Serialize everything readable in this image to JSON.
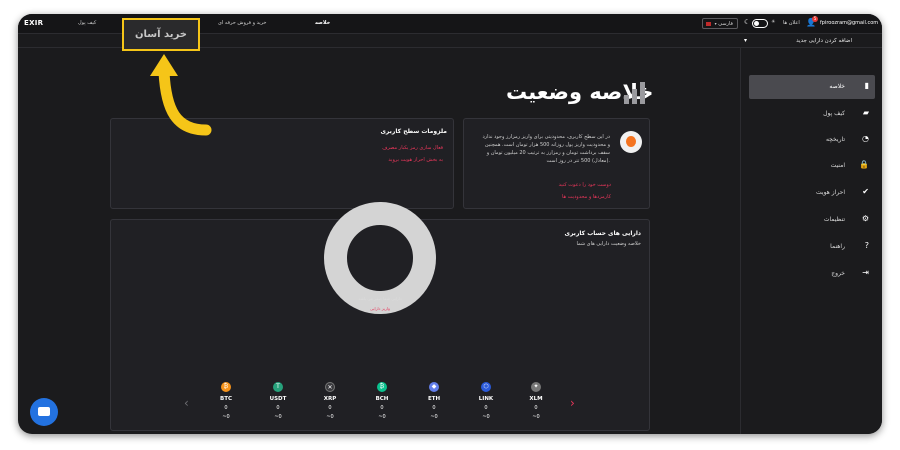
{
  "topbar": {
    "brand": "EXIR",
    "nav": [
      "کیف پول",
      "خرید آسان",
      "خرید و فروش حرفه ای",
      "خلاصه"
    ],
    "active_nav": "خلاصه",
    "language": "فارسی",
    "notifications_label": "اعلان ها",
    "notifications_count": "5",
    "email": "fpiroozram@gmail.com"
  },
  "subbar": {
    "add_asset": "اضافه کردن دارایی جدید"
  },
  "highlight": {
    "label": "خرید آسان",
    "color": "#f5c518"
  },
  "sidebar": {
    "items": [
      {
        "label": "خلاصه",
        "icon": "bar-chart-icon",
        "active": true
      },
      {
        "label": "کیف پول",
        "icon": "wallet-icon",
        "active": false
      },
      {
        "label": "تاریخچه",
        "icon": "history-icon",
        "active": false
      },
      {
        "label": "امنیت",
        "icon": "lock-icon",
        "active": false
      },
      {
        "label": "احراز هویت",
        "icon": "check-circle-icon",
        "active": false
      },
      {
        "label": "تنظیمات",
        "icon": "gear-icon",
        "active": false
      },
      {
        "label": "راهنما",
        "icon": "help-icon",
        "active": false
      },
      {
        "label": "خروج",
        "icon": "logout-icon",
        "active": false
      }
    ]
  },
  "main": {
    "page_title": "خلاصه وضعیت",
    "requirements_card": {
      "title": "ملزومات سطح کاربری",
      "links": [
        "فعال سازی رمز یکبار مصرف",
        "به بخش احراز هویت بروید"
      ]
    },
    "level_card": {
      "text": "در این سطح کاربری، محدودیتی برای واریز رمزارز وجود ندارد و محدودیت واریز پول روزانه 500 هزار تومان است. همچنین سقف برداشت تومان و رمزارز به ترتیب 20 میلیون تومان و (معادل) 500 تتر در روز است.",
      "links": [
        "دوست خود را دعوت کنید",
        "کارمزدها و محدودیت ها"
      ]
    },
    "assets_card": {
      "title": "دارایی های حساب کاربری",
      "subtitle": "خلاصه وضعیت دارایی های شما",
      "donut_text": "دارایی شما صفر می باشد",
      "donut_link": "واریز دارایی"
    },
    "coins": [
      {
        "symbol": "BTC",
        "amount": "0",
        "fiat": "~0",
        "color": "#f7931a",
        "glyph": "₿"
      },
      {
        "symbol": "USDT",
        "amount": "0",
        "fiat": "~0",
        "color": "#26a17b",
        "glyph": "T"
      },
      {
        "symbol": "XRP",
        "amount": "0",
        "fiat": "~0",
        "color": "#3a3a3e",
        "glyph": "✕"
      },
      {
        "symbol": "BCH",
        "amount": "0",
        "fiat": "~0",
        "color": "#0ac18e",
        "glyph": "₿"
      },
      {
        "symbol": "ETH",
        "amount": "0",
        "fiat": "~0",
        "color": "#627eea",
        "glyph": "◆"
      },
      {
        "symbol": "LINK",
        "amount": "0",
        "fiat": "~0",
        "color": "#2a5ada",
        "glyph": "⬡"
      },
      {
        "symbol": "XLM",
        "amount": "0",
        "fiat": "~0",
        "color": "#777777",
        "glyph": "✦"
      }
    ]
  }
}
